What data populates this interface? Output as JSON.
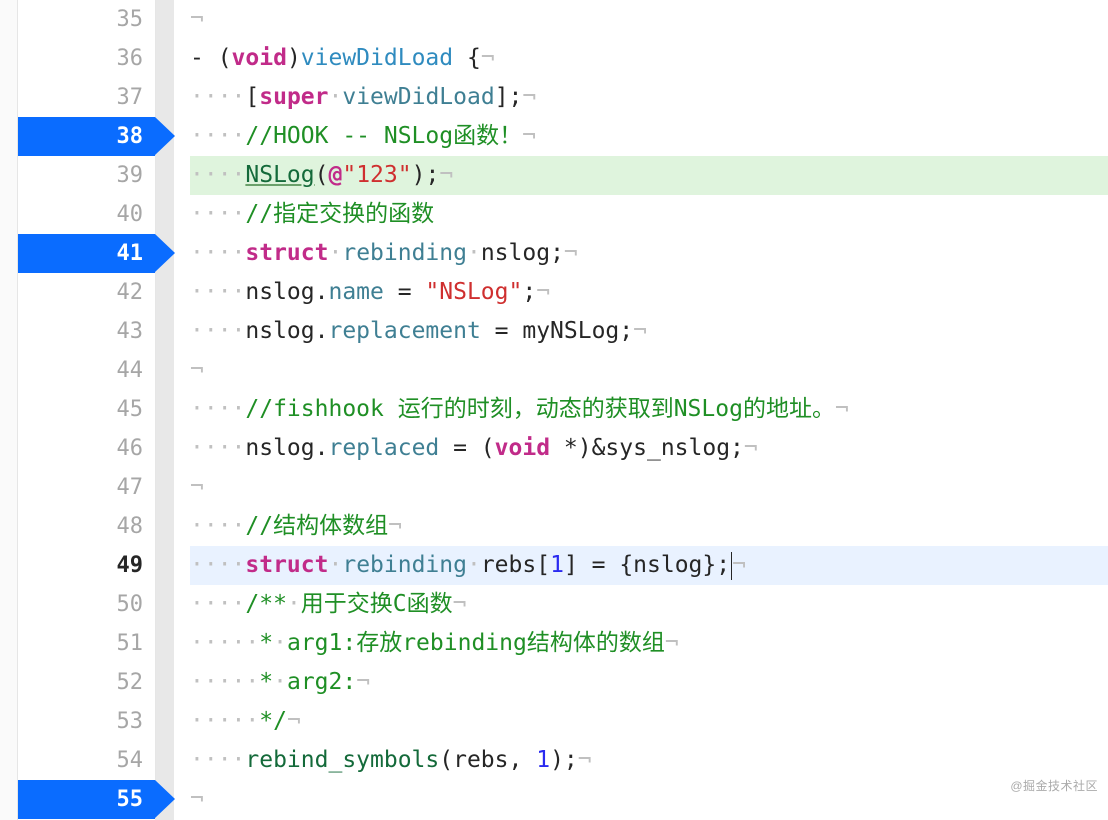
{
  "lines": [
    {
      "num": "35",
      "bp": false,
      "bg": "",
      "frags": [
        {
          "cls": "nl",
          "t": "¬"
        }
      ]
    },
    {
      "num": "36",
      "bp": false,
      "bg": "",
      "frags": [
        {
          "cls": "txt",
          "t": "- ("
        },
        {
          "cls": "kw",
          "t": "void"
        },
        {
          "cls": "txt",
          "t": ")"
        },
        {
          "cls": "fn",
          "t": "viewDidLoad"
        },
        {
          "cls": "txt",
          "t": " {"
        },
        {
          "cls": "nl",
          "t": "¬"
        }
      ]
    },
    {
      "num": "37",
      "bp": false,
      "bg": "",
      "frags": [
        {
          "cls": "dot",
          "t": "····"
        },
        {
          "cls": "txt",
          "t": "["
        },
        {
          "cls": "kw",
          "t": "super"
        },
        {
          "cls": "dot",
          "t": "·"
        },
        {
          "cls": "id",
          "t": "viewDidLoad"
        },
        {
          "cls": "txt",
          "t": "];"
        },
        {
          "cls": "nl",
          "t": "¬"
        }
      ]
    },
    {
      "num": "38",
      "bp": true,
      "bg": "",
      "frags": [
        {
          "cls": "dot",
          "t": "····"
        },
        {
          "cls": "cmt",
          "t": "//HOOK -- NSLog函数！"
        },
        {
          "cls": "nl",
          "t": "¬"
        }
      ]
    },
    {
      "num": "39",
      "bp": false,
      "bg": "highlight-green",
      "frags": [
        {
          "cls": "dot",
          "t": "····"
        },
        {
          "cls": "method underline",
          "t": "NSLog"
        },
        {
          "cls": "txt",
          "t": "("
        },
        {
          "cls": "kw",
          "t": "@"
        },
        {
          "cls": "str",
          "t": "\"123\""
        },
        {
          "cls": "txt",
          "t": ");"
        },
        {
          "cls": "nl",
          "t": "¬"
        }
      ]
    },
    {
      "num": "40",
      "bp": false,
      "bg": "",
      "frags": [
        {
          "cls": "dot",
          "t": "····"
        },
        {
          "cls": "cmt",
          "t": "//指定交换的函数"
        }
      ]
    },
    {
      "num": "41",
      "bp": true,
      "bg": "",
      "frags": [
        {
          "cls": "dot",
          "t": "····"
        },
        {
          "cls": "kw",
          "t": "struct"
        },
        {
          "cls": "dot",
          "t": "·"
        },
        {
          "cls": "id",
          "t": "rebinding"
        },
        {
          "cls": "dot",
          "t": "·"
        },
        {
          "cls": "txt",
          "t": "nslog;"
        },
        {
          "cls": "nl",
          "t": "¬"
        }
      ]
    },
    {
      "num": "42",
      "bp": false,
      "bg": "",
      "frags": [
        {
          "cls": "dot",
          "t": "····"
        },
        {
          "cls": "txt",
          "t": "nslog."
        },
        {
          "cls": "id",
          "t": "name"
        },
        {
          "cls": "txt",
          "t": " = "
        },
        {
          "cls": "str",
          "t": "\"NSLog\""
        },
        {
          "cls": "txt",
          "t": ";"
        },
        {
          "cls": "nl",
          "t": "¬"
        }
      ]
    },
    {
      "num": "43",
      "bp": false,
      "bg": "",
      "frags": [
        {
          "cls": "dot",
          "t": "····"
        },
        {
          "cls": "txt",
          "t": "nslog."
        },
        {
          "cls": "id",
          "t": "replacement"
        },
        {
          "cls": "txt",
          "t": " = myNSLog;"
        },
        {
          "cls": "nl",
          "t": "¬"
        }
      ]
    },
    {
      "num": "44",
      "bp": false,
      "bg": "",
      "frags": [
        {
          "cls": "nl",
          "t": "¬"
        }
      ]
    },
    {
      "num": "45",
      "bp": false,
      "bg": "",
      "frags": [
        {
          "cls": "dot",
          "t": "····"
        },
        {
          "cls": "cmt",
          "t": "//fishhook 运行的时刻，动态的获取到NSLog的地址。"
        },
        {
          "cls": "nl",
          "t": "¬"
        }
      ]
    },
    {
      "num": "46",
      "bp": false,
      "bg": "",
      "frags": [
        {
          "cls": "dot",
          "t": "····"
        },
        {
          "cls": "txt",
          "t": "nslog."
        },
        {
          "cls": "id",
          "t": "replaced"
        },
        {
          "cls": "txt",
          "t": " = ("
        },
        {
          "cls": "kw",
          "t": "void"
        },
        {
          "cls": "txt",
          "t": " *)&sys_nslog;"
        },
        {
          "cls": "nl",
          "t": "¬"
        }
      ]
    },
    {
      "num": "47",
      "bp": false,
      "bg": "",
      "frags": [
        {
          "cls": "nl",
          "t": "¬"
        }
      ]
    },
    {
      "num": "48",
      "bp": false,
      "bg": "",
      "frags": [
        {
          "cls": "dot",
          "t": "····"
        },
        {
          "cls": "cmt",
          "t": "//结构体数组"
        },
        {
          "cls": "nl",
          "t": "¬"
        }
      ]
    },
    {
      "num": "49",
      "bp": false,
      "bg": "highlight-blue",
      "current": true,
      "frags": [
        {
          "cls": "dot",
          "t": "····"
        },
        {
          "cls": "kw",
          "t": "struct"
        },
        {
          "cls": "dot",
          "t": "·"
        },
        {
          "cls": "id",
          "t": "rebinding"
        },
        {
          "cls": "dot",
          "t": "·"
        },
        {
          "cls": "txt",
          "t": "rebs["
        },
        {
          "cls": "num",
          "t": "1"
        },
        {
          "cls": "txt",
          "t": "] = {nslog};"
        },
        {
          "cls": "cursor",
          "t": ""
        },
        {
          "cls": "nl",
          "t": "¬"
        }
      ]
    },
    {
      "num": "50",
      "bp": false,
      "bg": "",
      "frags": [
        {
          "cls": "dot",
          "t": "····"
        },
        {
          "cls": "cmt",
          "t": "/**"
        },
        {
          "cls": "dot",
          "t": "·"
        },
        {
          "cls": "cmt",
          "t": "用于交换C函数"
        },
        {
          "cls": "nl",
          "t": "¬"
        }
      ]
    },
    {
      "num": "51",
      "bp": false,
      "bg": "",
      "frags": [
        {
          "cls": "dot",
          "t": "·····"
        },
        {
          "cls": "cmt",
          "t": "*"
        },
        {
          "cls": "dot",
          "t": "·"
        },
        {
          "cls": "cmt",
          "t": "arg1:存放rebinding结构体的数组"
        },
        {
          "cls": "nl",
          "t": "¬"
        }
      ]
    },
    {
      "num": "52",
      "bp": false,
      "bg": "",
      "frags": [
        {
          "cls": "dot",
          "t": "·····"
        },
        {
          "cls": "cmt",
          "t": "*"
        },
        {
          "cls": "dot",
          "t": "·"
        },
        {
          "cls": "cmt",
          "t": "arg2:"
        },
        {
          "cls": "nl",
          "t": "¬"
        }
      ]
    },
    {
      "num": "53",
      "bp": false,
      "bg": "",
      "frags": [
        {
          "cls": "dot",
          "t": "·····"
        },
        {
          "cls": "cmt",
          "t": "*/"
        },
        {
          "cls": "nl",
          "t": "¬"
        }
      ]
    },
    {
      "num": "54",
      "bp": false,
      "bg": "",
      "frags": [
        {
          "cls": "dot",
          "t": "····"
        },
        {
          "cls": "method",
          "t": "rebind_symbols"
        },
        {
          "cls": "txt",
          "t": "(rebs, "
        },
        {
          "cls": "num",
          "t": "1"
        },
        {
          "cls": "txt",
          "t": ");"
        },
        {
          "cls": "nl",
          "t": "¬"
        }
      ]
    },
    {
      "num": "55",
      "bp": true,
      "bg": "",
      "frags": [
        {
          "cls": "nl",
          "t": "¬"
        }
      ]
    }
  ],
  "watermark": "@掘金技术社区"
}
